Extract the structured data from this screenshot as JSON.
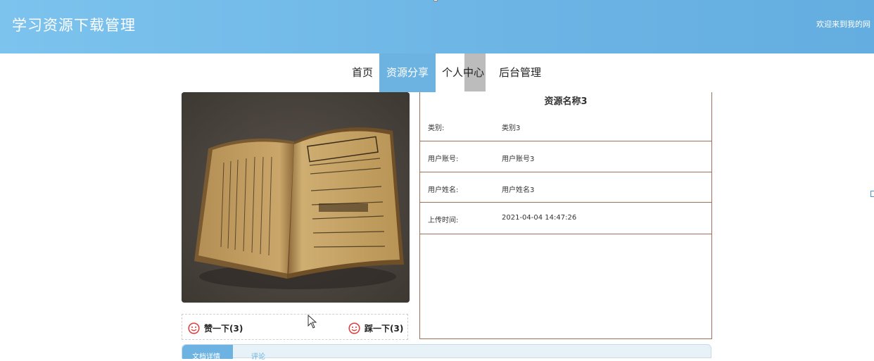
{
  "header": {
    "site_title": "学习资源下载管理",
    "welcome_text": "欢迎来到我的网"
  },
  "nav": {
    "items": [
      {
        "label": "首页"
      },
      {
        "label": "资源分享",
        "active": true
      },
      {
        "label": "个人中心"
      },
      {
        "label": "后台管理"
      }
    ]
  },
  "resource": {
    "name": "资源名称3",
    "image_icon": "old-open-book-photo",
    "fields": [
      {
        "label": "类别:",
        "value": "类别3"
      },
      {
        "label": "用户账号:",
        "value": "用户账号3"
      },
      {
        "label": "用户姓名:",
        "value": "用户姓名3"
      },
      {
        "label": "上传时间:",
        "value": "2021-04-04 14:47:26"
      }
    ]
  },
  "votes": {
    "like_label": "赞一下(3)",
    "dislike_label": "踩一下(3)",
    "icon": "smile-icon"
  },
  "tabs": {
    "detail_label": "文档详情",
    "comment_label": "评论"
  },
  "colors": {
    "header_blue": "#6cb4e4",
    "nav_active": "#6cb3e2",
    "panel_border": "#9c7156",
    "vote_icon": "#e03a3a"
  }
}
